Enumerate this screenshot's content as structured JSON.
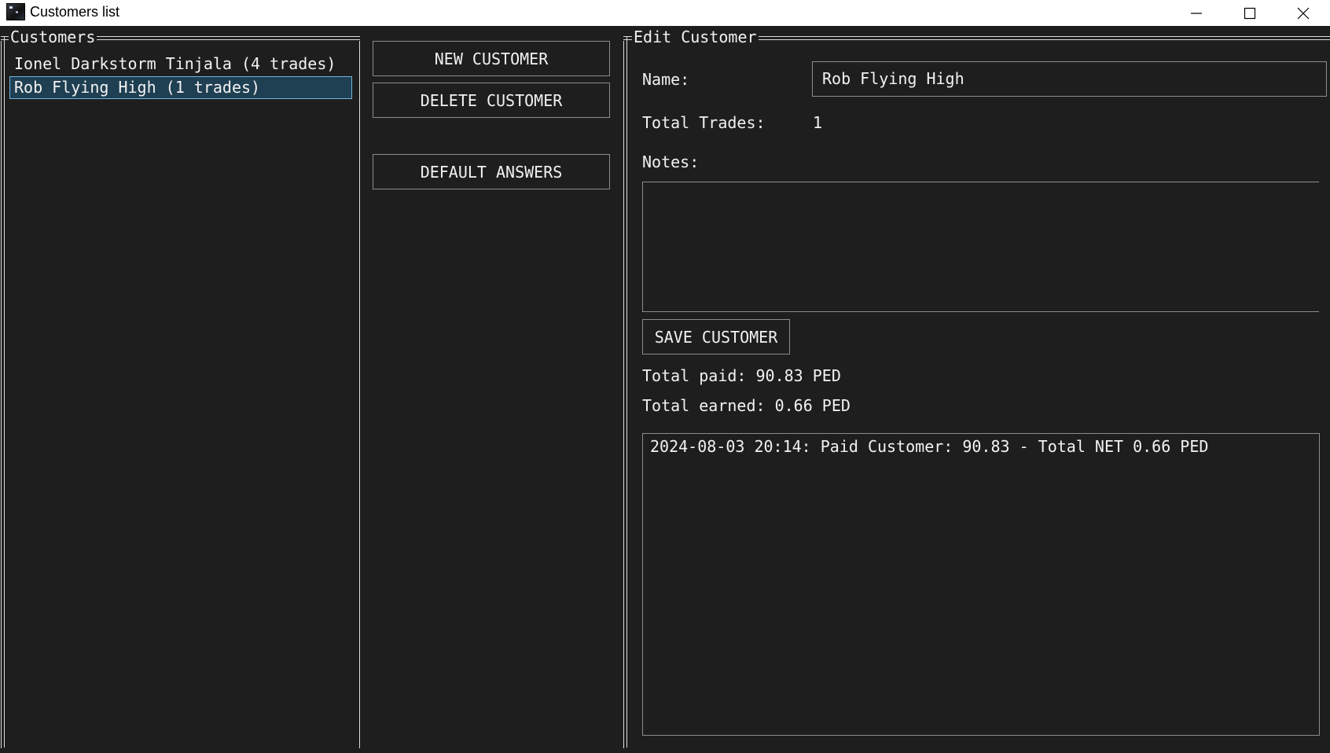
{
  "window": {
    "title": "Customers list",
    "icon": "app-icon",
    "controls": {
      "minimize_icon": "minimize-icon",
      "maximize_icon": "maximize-icon",
      "close_icon": "close-icon"
    }
  },
  "customers_panel": {
    "title": "Customers",
    "items": [
      {
        "label": "Ionel Darkstorm Tinjala (4 trades)",
        "selected": false
      },
      {
        "label": "Rob Flying High (1 trades)",
        "selected": true
      }
    ]
  },
  "actions": {
    "new_customer": "NEW CUSTOMER",
    "delete_customer": "DELETE CUSTOMER",
    "default_answers": "DEFAULT ANSWERS"
  },
  "edit_panel": {
    "title": "Edit Customer",
    "name_label": "Name:",
    "name_value": "Rob Flying High",
    "total_trades_label": "Total Trades:",
    "total_trades_value": "1",
    "notes_label": "Notes:",
    "notes_value": "",
    "save_button": "SAVE CUSTOMER",
    "total_paid": "Total paid: 90.83 PED",
    "total_earned": "Total earned: 0.66 PED",
    "history": [
      "2024-08-03 20:14: Paid Customer: 90.83 - Total NET 0.66 PED"
    ]
  },
  "colors": {
    "background": "#1e1e1e",
    "text": "#f2f2f2",
    "selection_bg": "#1f3f52",
    "selection_border": "#6fb6e0",
    "border": "#8c8c8c",
    "titlebar": "#ffffff"
  }
}
